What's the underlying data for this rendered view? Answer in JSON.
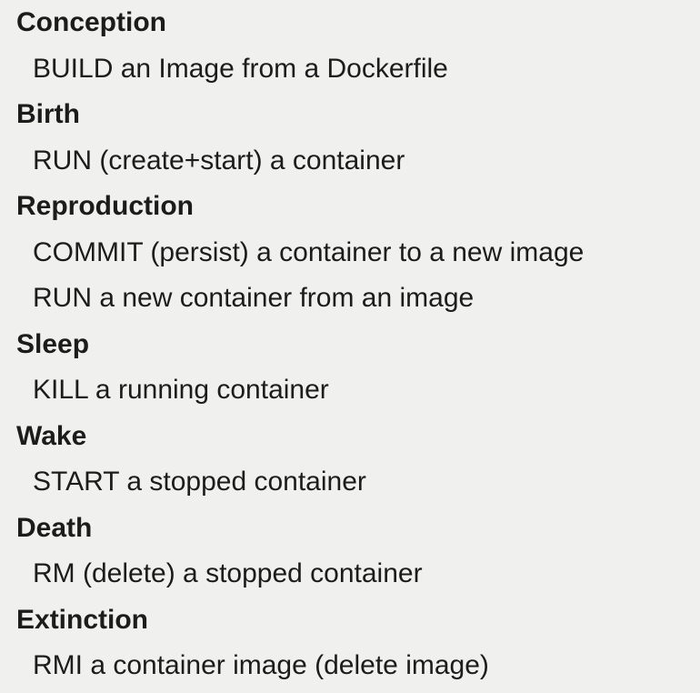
{
  "stages": [
    {
      "heading": "Conception",
      "items": [
        "BUILD an Image from a Dockerfile"
      ]
    },
    {
      "heading": "Birth",
      "items": [
        "RUN (create+start) a container"
      ]
    },
    {
      "heading": "Reproduction",
      "items": [
        "COMMIT (persist) a container to a new image",
        "RUN a new container from an image"
      ]
    },
    {
      "heading": "Sleep",
      "items": [
        "KILL a running container"
      ]
    },
    {
      "heading": "Wake",
      "items": [
        "START a stopped container"
      ]
    },
    {
      "heading": "Death",
      "items": [
        "RM (delete) a stopped container"
      ]
    },
    {
      "heading": "Extinction",
      "items": [
        "RMI a container image (delete image)"
      ]
    }
  ]
}
